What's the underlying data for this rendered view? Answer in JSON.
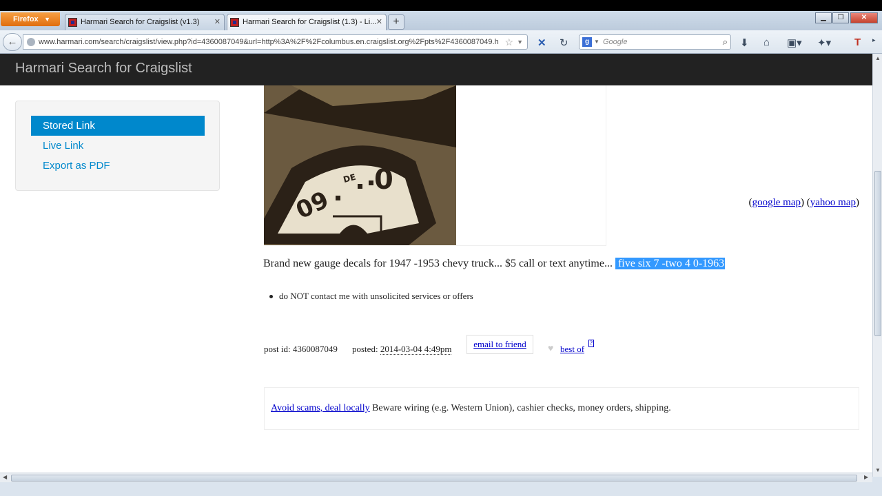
{
  "browser": {
    "firefox_button": "Firefox",
    "tabs": [
      {
        "label": "Harmari Search for Craigslist (v1.3)",
        "active": false
      },
      {
        "label": "Harmari Search for Craigslist (1.3) - Li...",
        "active": true
      }
    ],
    "new_tab": "+",
    "url": "www.harmari.com/search/craigslist/view.php?id=4360087049&url=http%3A%2F%2Fcolumbus.en.craigslist.org%2Fpts%2F4360087049.h",
    "search_placeholder": "Google"
  },
  "site": {
    "brand": "Harmari Search for Craigslist",
    "sidebar": [
      {
        "label": "Stored Link",
        "active": true
      },
      {
        "label": "Live Link",
        "active": false
      },
      {
        "label": "Export as PDF",
        "active": false
      }
    ]
  },
  "photo": {
    "gauge_reading": "09 .DE . 0"
  },
  "listing": {
    "map_open": "(",
    "google_map": "google map",
    "map_mid": ") (",
    "yahoo_map": "yahoo map",
    "map_close": ")",
    "body": "Brand new gauge decals for 1947 -1953 chevy truck... $5 call or text anytime...",
    "body_selected": "five six 7 -two 4 0-1963",
    "notice": "do NOT contact me with unsolicited services or offers",
    "post_id_label": "post id: 4360087049",
    "posted_label": "posted:",
    "posted_date": "2014-03-04 4:49pm",
    "email_friend": "email to friend",
    "best_of": "best of",
    "help": "?",
    "scam_link": "Avoid scams, deal locally",
    "scam_text": "Beware wiring (e.g. Western Union), cashier checks, money orders, shipping."
  },
  "colors": {
    "accent": "#0088cc",
    "selection": "#3399ff",
    "header_bg": "#222222"
  }
}
